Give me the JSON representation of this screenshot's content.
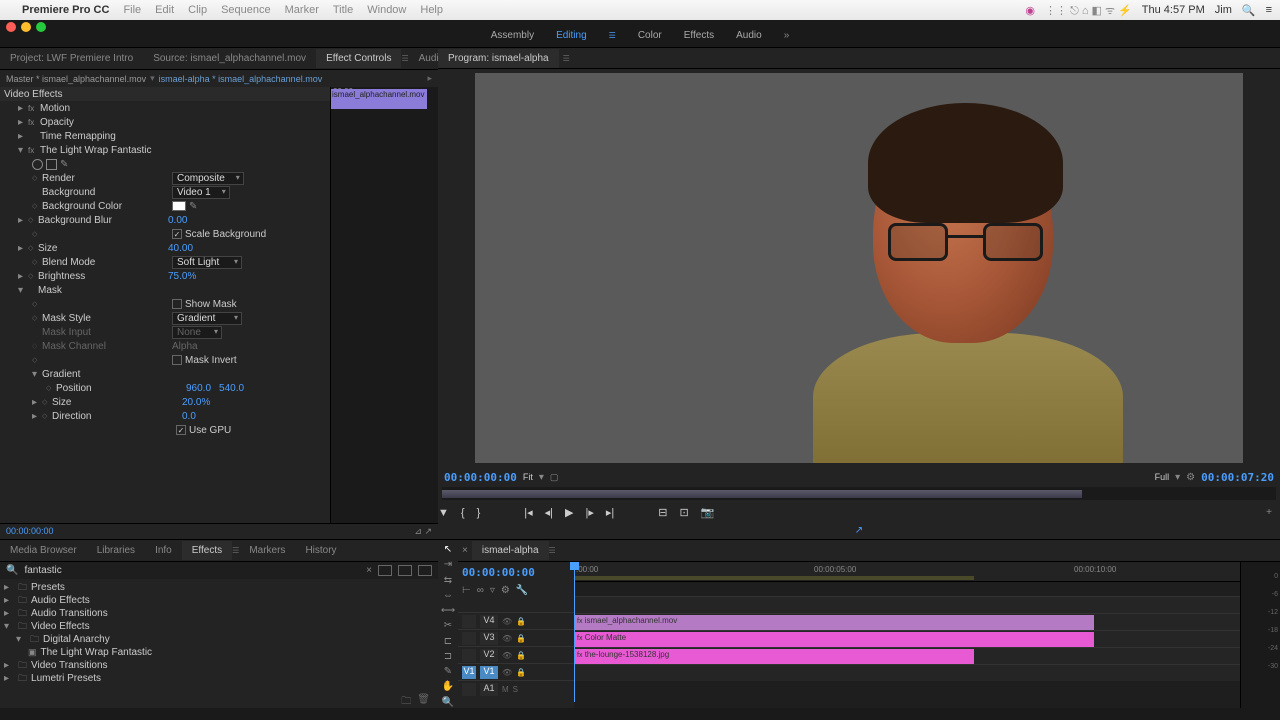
{
  "menubar": {
    "apple": "",
    "app": "Premiere Pro CC",
    "items": [
      "File",
      "Edit",
      "Clip",
      "Sequence",
      "Marker",
      "Title",
      "Window",
      "Help"
    ],
    "clock": "Thu 4:57 PM",
    "user": "Jim"
  },
  "workspaces": {
    "items": [
      "Assembly",
      "Editing",
      "Color",
      "Effects",
      "Audio"
    ],
    "active": 1
  },
  "topLeftTabs": {
    "items": [
      "Project: LWF Premiere Intro",
      "Source: ismael_alphachannel.mov",
      "Effect Controls",
      "Audio Clip M"
    ],
    "active": 2
  },
  "effectControls": {
    "masterPath": "Master * ismael_alphachannel.mov",
    "clipPath": "ismael-alpha * ismael_alphachannel.mov",
    "videoEffectsHeader": "Video Effects",
    "motion": "Motion",
    "opacity": "Opacity",
    "timeRemap": "Time Remapping",
    "pluginName": "The Light Wrap Fantastic",
    "render": {
      "label": "Render",
      "value": "Composite"
    },
    "background": {
      "label": "Background",
      "value": "Video 1"
    },
    "bgColor": {
      "label": "Background Color"
    },
    "bgBlur": {
      "label": "Background Blur",
      "value": "0.00"
    },
    "scaleBg": {
      "label": "Scale Background",
      "checked": true
    },
    "size": {
      "label": "Size",
      "value": "40.00"
    },
    "blendMode": {
      "label": "Blend Mode",
      "value": "Soft Light"
    },
    "brightness": {
      "label": "Brightness",
      "value": "75.0%"
    },
    "mask": {
      "label": "Mask"
    },
    "showMask": {
      "label": "Show Mask",
      "checked": false
    },
    "maskStyle": {
      "label": "Mask Style",
      "value": "Gradient"
    },
    "maskInput": {
      "label": "Mask Input",
      "value": "None"
    },
    "maskChannel": {
      "label": "Mask Channel",
      "value": "Alpha"
    },
    "maskInvert": {
      "label": "Mask Invert",
      "checked": false
    },
    "gradient": {
      "label": "Gradient"
    },
    "position": {
      "label": "Position",
      "x": "960.0",
      "y": "540.0"
    },
    "gradSize": {
      "label": "Size",
      "value": "20.0%"
    },
    "direction": {
      "label": "Direction",
      "value": "0.0"
    },
    "useGPU": {
      "label": "Use GPU",
      "checked": true
    },
    "stripClip": "ismael_alphachannel.mov",
    "stripTC": "00:00",
    "footerTC": "00:00:00:00"
  },
  "program": {
    "title": "Program: ismael-alpha",
    "tcLeft": "00:00:00:00",
    "fit": "Fit",
    "full": "Full",
    "tcRight": "00:00:07:20"
  },
  "effectsPanel": {
    "tabs": [
      "Media Browser",
      "Libraries",
      "Info",
      "Effects",
      "Markers",
      "History"
    ],
    "active": 3,
    "search": "fantastic",
    "tree": {
      "presets": "Presets",
      "audioEffects": "Audio Effects",
      "audioTransitions": "Audio Transitions",
      "videoEffects": "Video Effects",
      "digitalAnarchy": "Digital Anarchy",
      "plugin": "The Light Wrap Fantastic",
      "videoTransitions": "Video Transitions",
      "lumetri": "Lumetri Presets"
    }
  },
  "timeline": {
    "sequence": "ismael-alpha",
    "tc": "00:00:00:00",
    "ruler": {
      "t0": ":00:00",
      "t1": "00:00:05:00",
      "t2": "00:00:10:00"
    },
    "tracks": {
      "v4": "V4",
      "v3": "V3",
      "v2": "V2",
      "v1": "V1",
      "a1": "A1"
    },
    "clips": {
      "v3": "ismael_alphachannel.mov",
      "v2": "Color Matte",
      "v1": "the-lounge-1538128.jpg"
    }
  },
  "meters": [
    "0",
    "-6",
    "-12",
    "-18",
    "-24",
    "-30"
  ]
}
